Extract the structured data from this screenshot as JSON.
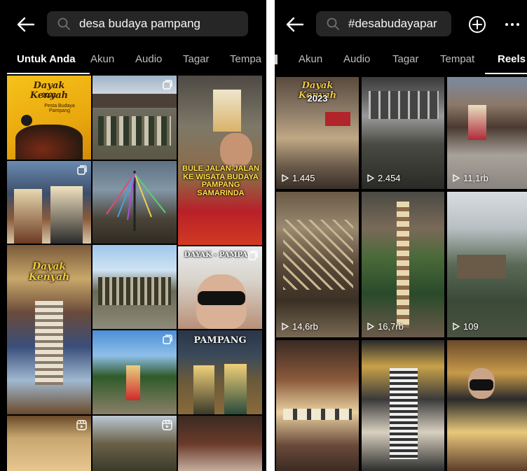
{
  "left": {
    "search_query": "desa budaya pampang",
    "tabs": [
      {
        "label": "Untuk Anda",
        "active": true
      },
      {
        "label": "Akun",
        "active": false
      },
      {
        "label": "Audio",
        "active": false
      },
      {
        "label": "Tagar",
        "active": false
      },
      {
        "label": "Tempa",
        "active": false
      }
    ],
    "tiles": [
      {
        "caption_main": "Dayak Kenyah",
        "caption_sub": "Pesta Budaya Pampang",
        "caption_year": "2021"
      },
      {
        "icon": "multi-photo-icon"
      },
      {
        "caption": "BULE JALAN-JALAN KE WISATA BUDAYA PAMPANG SAMARINDA"
      },
      {
        "icon": "multi-photo-icon"
      },
      {},
      {},
      {
        "caption_main": "Dayak Kenyah"
      },
      {},
      {
        "caption": "DAYAK - PAMPA",
        "icon": "multi-photo-icon"
      },
      {},
      {
        "icon": "multi-photo-icon"
      },
      {
        "caption": "PAMPANG"
      },
      {
        "icon": "reel-icon"
      },
      {
        "icon": "reel-icon"
      },
      {}
    ]
  },
  "right": {
    "search_query": "#desabudayapar",
    "tabs": [
      {
        "label": "Akun",
        "active": false
      },
      {
        "label": "Audio",
        "active": false
      },
      {
        "label": "Tagar",
        "active": false
      },
      {
        "label": "Tempat",
        "active": false
      },
      {
        "label": "Reels",
        "active": true
      }
    ],
    "tiles": [
      {
        "views": "1.445",
        "caption_main": "Dayak Kenyah",
        "caption_year": "2023"
      },
      {
        "views": "2.454"
      },
      {
        "views": "11,1rb"
      },
      {
        "views": "14,6rb"
      },
      {
        "views": "16,7rb"
      },
      {
        "views": "109"
      },
      {},
      {},
      {}
    ]
  },
  "colors": {
    "background": "#000000",
    "search_bg": "#262626",
    "text_primary": "#ffffff",
    "text_secondary": "#bdbdbd"
  }
}
